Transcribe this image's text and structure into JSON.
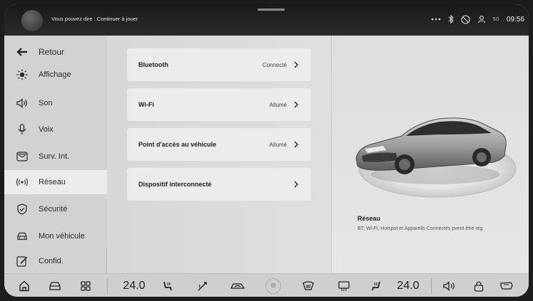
{
  "status_bar": {
    "voice_prompt": "Vous pouvez dire : Continuer à jouer",
    "signal": "5G",
    "time": "09:56"
  },
  "sidebar": {
    "back_label": "Retour",
    "items": [
      {
        "label": "Affichage",
        "icon": "brightness-icon"
      },
      {
        "label": "Son",
        "icon": "speaker-icon"
      },
      {
        "label": "Voix",
        "icon": "microphone-icon"
      },
      {
        "label": "Surv. Int.",
        "icon": "camera-icon"
      },
      {
        "label": "Réseau",
        "icon": "wireless-signal-icon",
        "active": true
      },
      {
        "label": "Sécurité",
        "icon": "shield-icon"
      },
      {
        "label": "Mon véhicule",
        "icon": "car-icon"
      },
      {
        "label": "Confid.",
        "icon": "edit-icon"
      }
    ]
  },
  "main": {
    "rows": [
      {
        "label": "Bluetooth",
        "status": "Connecté"
      },
      {
        "label": "Wi-Fi",
        "status": "Allumé"
      },
      {
        "label": "Point d'accès au véhicule",
        "status": "Allumé"
      },
      {
        "label": "Dispositif interconnecté",
        "status": ""
      }
    ]
  },
  "pane": {
    "title": "Réseau",
    "description": "BT, Wi-Fi, Hotspot et Appareils Connectés pvent être rég"
  },
  "dock": {
    "left_temp": "24.0",
    "right_temp": "24.0",
    "fan_symbol": "⊛"
  },
  "colors": {
    "accent_active_bg": "#ececec",
    "dock_bg": "#cfcfcf",
    "status_bar_bg": "#1a1a1a"
  }
}
